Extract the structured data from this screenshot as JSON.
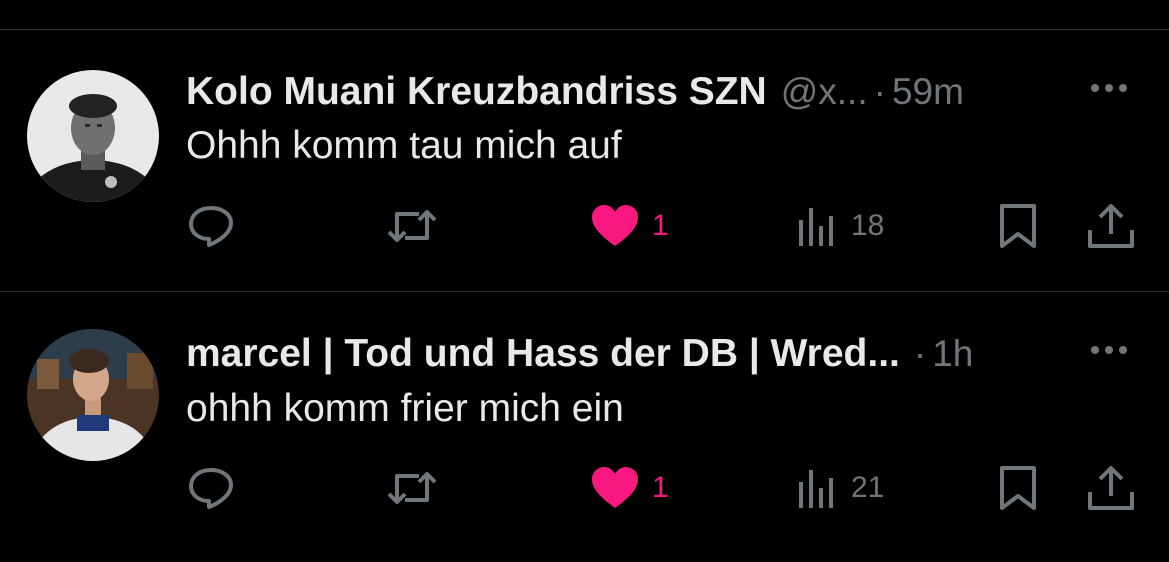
{
  "colors": {
    "background": "#000000",
    "text": "#e7e9ea",
    "muted": "#71767b",
    "like_active": "#f91880",
    "divider": "#2f3336"
  },
  "tweets": [
    {
      "display_name": "Kolo Muani Kreuzbandriss SZN",
      "handle": "@x...",
      "separator": "·",
      "time": "59m",
      "text": "Ohhh komm tau mich auf",
      "likes": "1",
      "views": "18",
      "liked": true
    },
    {
      "display_name": "marcel | Tod und Hass der DB | Wred...",
      "handle": "",
      "separator": "·",
      "time": "1h",
      "text": "ohhh komm frier mich ein",
      "likes": "1",
      "views": "21",
      "liked": true
    }
  ],
  "icons": {
    "more": "more-horizontal-icon",
    "reply": "reply-icon",
    "retweet": "retweet-icon",
    "like": "heart-filled-icon",
    "views": "views-bar-chart-icon",
    "bookmark": "bookmark-icon",
    "share": "share-upload-icon"
  }
}
